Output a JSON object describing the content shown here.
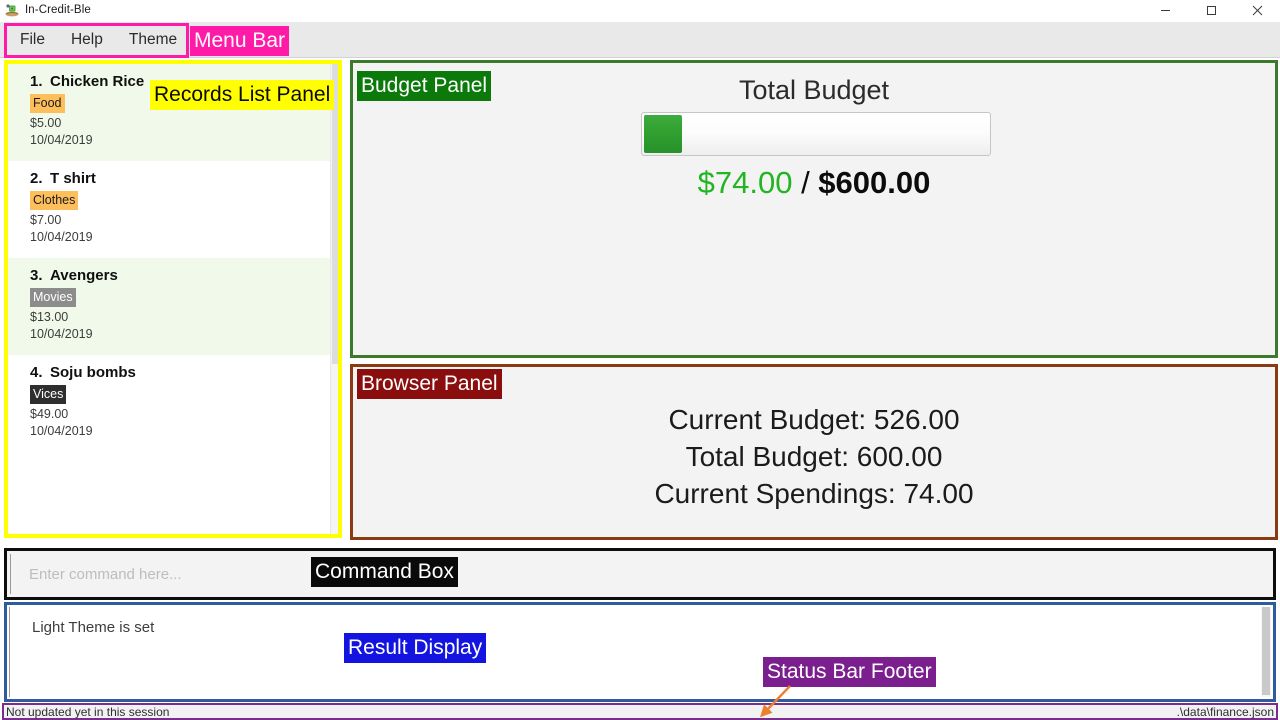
{
  "window": {
    "title": "In-Credit-Ble",
    "icon": "app-icon",
    "controls": [
      {
        "name": "minimize",
        "glyph": "minimize-icon"
      },
      {
        "name": "maximize",
        "glyph": "maximize-icon"
      },
      {
        "name": "close",
        "glyph": "close-icon"
      }
    ]
  },
  "menu": {
    "items": [
      "File",
      "Help",
      "Theme"
    ]
  },
  "records": [
    {
      "index": "1.",
      "name": "Chicken Rice",
      "category": "Food",
      "category_style": "food",
      "amount": "$5.00",
      "date": "10/04/2019"
    },
    {
      "index": "2.",
      "name": "T shirt",
      "category": "Clothes",
      "category_style": "clothes",
      "amount": "$7.00",
      "date": "10/04/2019"
    },
    {
      "index": "3.",
      "name": "Avengers",
      "category": "Movies",
      "category_style": "movies",
      "amount": "$13.00",
      "date": "10/04/2019"
    },
    {
      "index": "4.",
      "name": "Soju bombs",
      "category": "Vices",
      "category_style": "vices",
      "amount": "$49.00",
      "date": "10/04/2019"
    }
  ],
  "budget": {
    "title": "Total Budget",
    "spent": "$74.00",
    "separator": " / ",
    "total": "$600.00",
    "progress_percent": 11,
    "fill_color": "#2e9e2e",
    "spent_color": "#22b422"
  },
  "browser": {
    "lines": [
      "Current Budget: 526.00",
      "Total Budget: 600.00",
      "Current Spendings: 74.00"
    ]
  },
  "command": {
    "placeholder": "Enter command here...",
    "value": ""
  },
  "result": {
    "text": "Light Theme is set"
  },
  "status": {
    "left": "Not updated yet in this session",
    "right": ".\\data\\finance.json"
  },
  "annotations": {
    "menu_bar": "Menu Bar",
    "records_list_panel": "Records List Panel",
    "budget_panel": "Budget Panel",
    "browser_panel": "Browser Panel",
    "command_box": "Command Box",
    "result_display": "Result Display",
    "status_bar_footer": "Status Bar Footer"
  },
  "colors": {
    "annotation_menu": "#ff1aa8",
    "annotation_records": "#ffff00",
    "annotation_budget": "#0b7a0b",
    "annotation_browser": "#8b0e0e",
    "annotation_command": "#0a0a0a",
    "annotation_result": "#1414e0",
    "annotation_status": "#7b1f8e",
    "arrow": "#ed8030"
  }
}
